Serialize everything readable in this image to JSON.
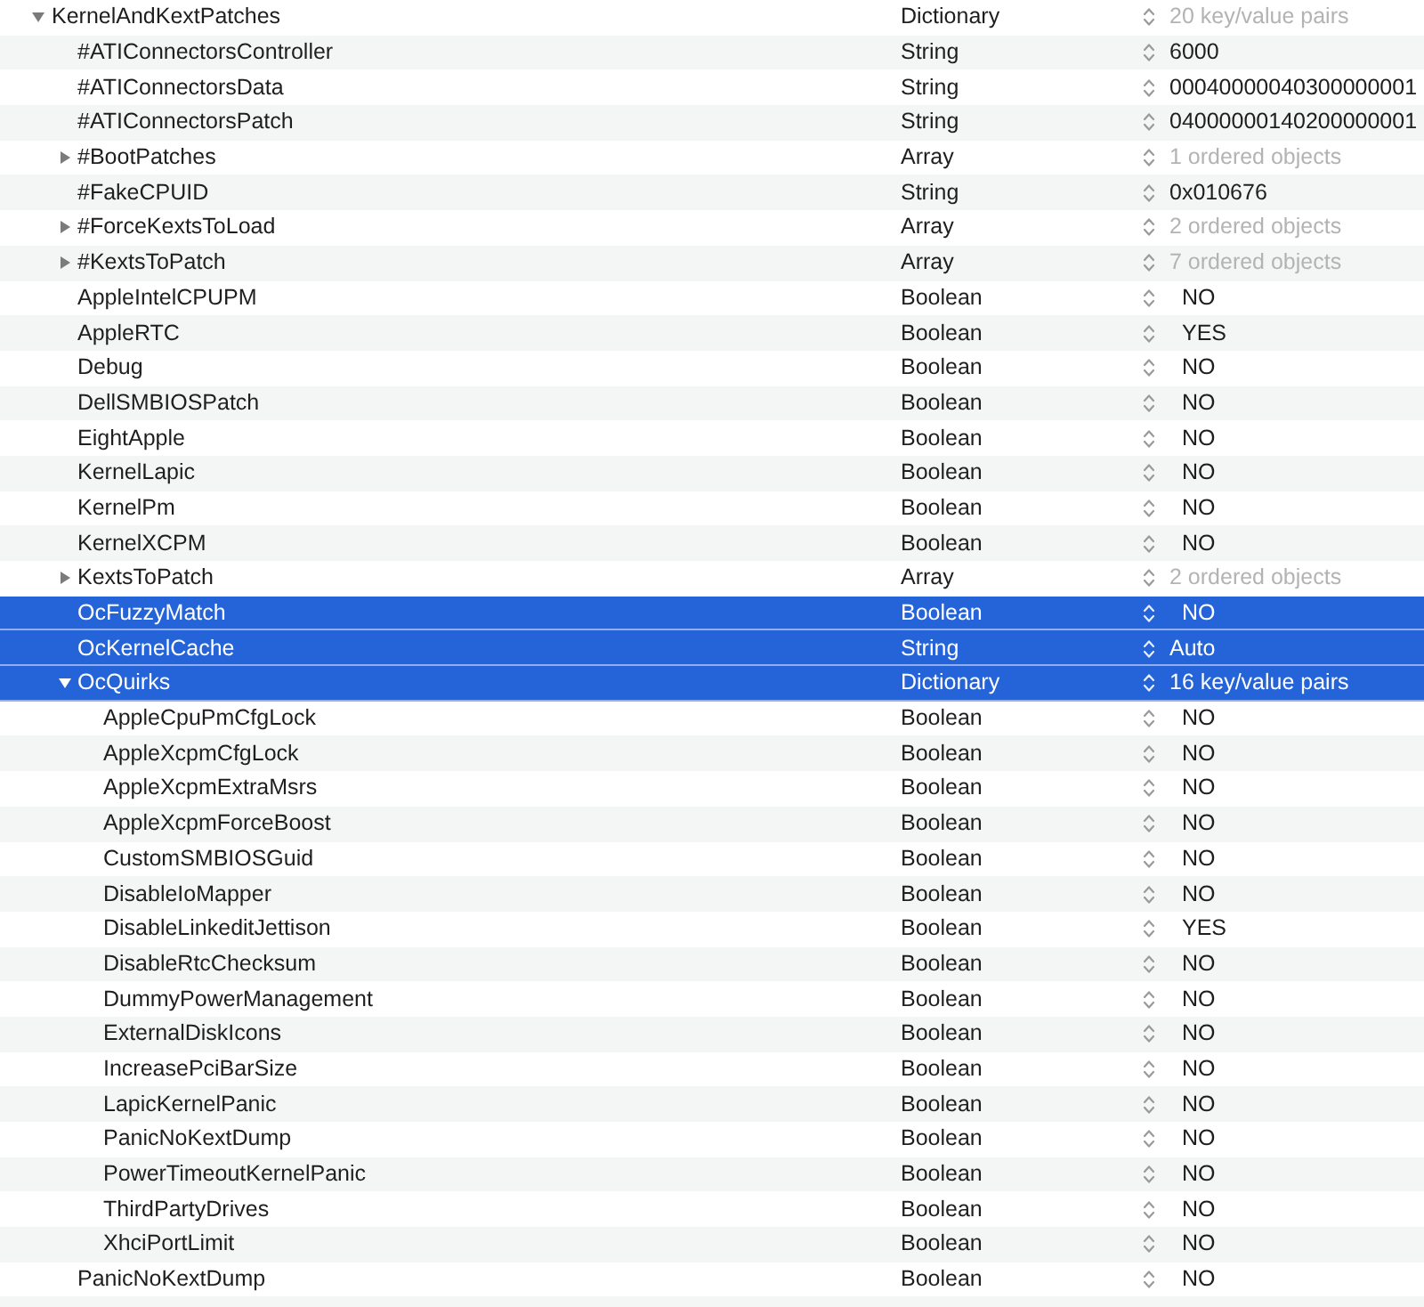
{
  "rows": [
    {
      "key": "KernelAndKextPatches",
      "type": "Dictionary",
      "kind": "dictionary",
      "value": "20 key/value pairs",
      "expanded": true,
      "selected": false,
      "children": [
        {
          "key": "#ATIConnectorsController",
          "type": "String",
          "kind": "string",
          "value": "6000",
          "selected": false
        },
        {
          "key": "#ATIConnectorsData",
          "type": "String",
          "kind": "string",
          "value": "00040000040300000001",
          "selected": false
        },
        {
          "key": "#ATIConnectorsPatch",
          "type": "String",
          "kind": "string",
          "value": "04000000140200000001",
          "selected": false
        },
        {
          "key": "#BootPatches",
          "type": "Array",
          "kind": "array",
          "value": "1 ordered objects",
          "expanded": false,
          "selected": false
        },
        {
          "key": "#FakeCPUID",
          "type": "String",
          "kind": "string",
          "value": "0x010676",
          "selected": false
        },
        {
          "key": "#ForceKextsToLoad",
          "type": "Array",
          "kind": "array",
          "value": "2 ordered objects",
          "expanded": false,
          "selected": false
        },
        {
          "key": "#KextsToPatch",
          "type": "Array",
          "kind": "array",
          "value": "7 ordered objects",
          "expanded": false,
          "selected": false
        },
        {
          "key": "AppleIntelCPUPM",
          "type": "Boolean",
          "kind": "boolean",
          "value": "NO",
          "selected": false
        },
        {
          "key": "AppleRTC",
          "type": "Boolean",
          "kind": "boolean",
          "value": "YES",
          "selected": false
        },
        {
          "key": "Debug",
          "type": "Boolean",
          "kind": "boolean",
          "value": "NO",
          "selected": false
        },
        {
          "key": "DellSMBIOSPatch",
          "type": "Boolean",
          "kind": "boolean",
          "value": "NO",
          "selected": false
        },
        {
          "key": "EightApple",
          "type": "Boolean",
          "kind": "boolean",
          "value": "NO",
          "selected": false
        },
        {
          "key": "KernelLapic",
          "type": "Boolean",
          "kind": "boolean",
          "value": "NO",
          "selected": false
        },
        {
          "key": "KernelPm",
          "type": "Boolean",
          "kind": "boolean",
          "value": "NO",
          "selected": false
        },
        {
          "key": "KernelXCPM",
          "type": "Boolean",
          "kind": "boolean",
          "value": "NO",
          "selected": false
        },
        {
          "key": "KextsToPatch",
          "type": "Array",
          "kind": "array",
          "value": "2 ordered objects",
          "expanded": false,
          "selected": false
        },
        {
          "key": "OcFuzzyMatch",
          "type": "Boolean",
          "kind": "boolean",
          "value": "NO",
          "selected": true
        },
        {
          "key": "OcKernelCache",
          "type": "String",
          "kind": "string",
          "value": "Auto",
          "selected": true
        },
        {
          "key": "OcQuirks",
          "type": "Dictionary",
          "kind": "dictionary",
          "value": "16 key/value pairs",
          "expanded": true,
          "selected": true,
          "children": [
            {
              "key": "AppleCpuPmCfgLock",
              "type": "Boolean",
              "kind": "boolean",
              "value": "NO",
              "selected": false
            },
            {
              "key": "AppleXcpmCfgLock",
              "type": "Boolean",
              "kind": "boolean",
              "value": "NO",
              "selected": false
            },
            {
              "key": "AppleXcpmExtraMsrs",
              "type": "Boolean",
              "kind": "boolean",
              "value": "NO",
              "selected": false
            },
            {
              "key": "AppleXcpmForceBoost",
              "type": "Boolean",
              "kind": "boolean",
              "value": "NO",
              "selected": false
            },
            {
              "key": "CustomSMBIOSGuid",
              "type": "Boolean",
              "kind": "boolean",
              "value": "NO",
              "selected": false
            },
            {
              "key": "DisableIoMapper",
              "type": "Boolean",
              "kind": "boolean",
              "value": "NO",
              "selected": false
            },
            {
              "key": "DisableLinkeditJettison",
              "type": "Boolean",
              "kind": "boolean",
              "value": "YES",
              "selected": false
            },
            {
              "key": "DisableRtcChecksum",
              "type": "Boolean",
              "kind": "boolean",
              "value": "NO",
              "selected": false
            },
            {
              "key": "DummyPowerManagement",
              "type": "Boolean",
              "kind": "boolean",
              "value": "NO",
              "selected": false
            },
            {
              "key": "ExternalDiskIcons",
              "type": "Boolean",
              "kind": "boolean",
              "value": "NO",
              "selected": false
            },
            {
              "key": "IncreasePciBarSize",
              "type": "Boolean",
              "kind": "boolean",
              "value": "NO",
              "selected": false
            },
            {
              "key": "LapicKernelPanic",
              "type": "Boolean",
              "kind": "boolean",
              "value": "NO",
              "selected": false
            },
            {
              "key": "PanicNoKextDump",
              "type": "Boolean",
              "kind": "boolean",
              "value": "NO",
              "selected": false
            },
            {
              "key": "PowerTimeoutKernelPanic",
              "type": "Boolean",
              "kind": "boolean",
              "value": "NO",
              "selected": false
            },
            {
              "key": "ThirdPartyDrives",
              "type": "Boolean",
              "kind": "boolean",
              "value": "NO",
              "selected": false
            },
            {
              "key": "XhciPortLimit",
              "type": "Boolean",
              "kind": "boolean",
              "value": "NO",
              "selected": false
            }
          ]
        },
        {
          "key": "PanicNoKextDump",
          "type": "Boolean",
          "kind": "boolean",
          "value": "NO",
          "selected": false
        }
      ]
    }
  ]
}
